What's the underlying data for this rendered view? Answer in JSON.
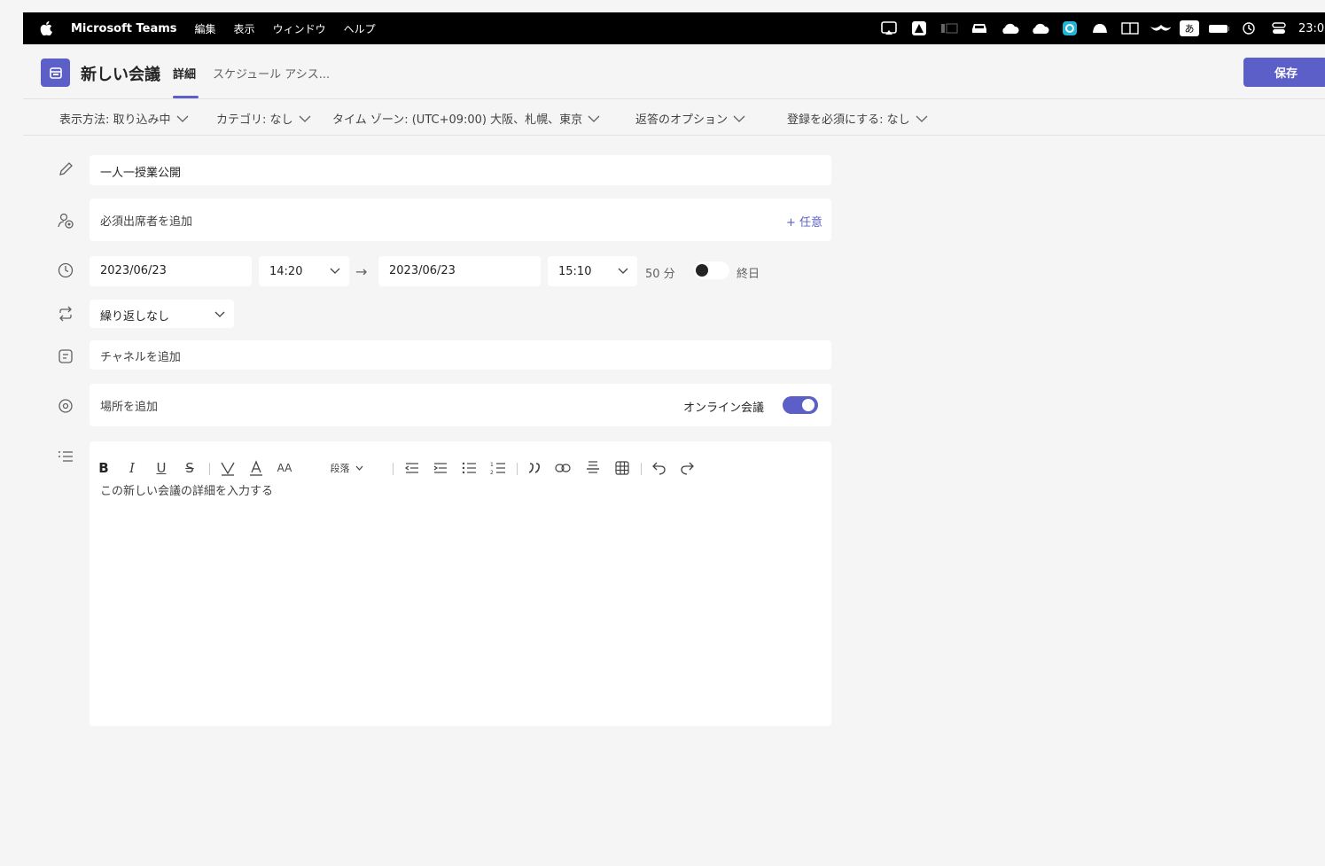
{
  "menubar": {
    "app": "Microsoft Teams",
    "items": [
      "編集",
      "表示",
      "ウィンドウ",
      "ヘルプ"
    ],
    "status_icons": [
      "screen-mirror-icon",
      "adobe-icon",
      "dots-icon",
      "car-icon",
      "cloud-icon",
      "cloud-icon",
      "edge-icon",
      "bell-icon",
      "book-icon",
      "mustache-icon",
      "input-method-icon",
      "battery-icon",
      "time-machine-icon",
      "control-center-icon"
    ],
    "input_method": "あ",
    "clock": "23:0"
  },
  "titlebar": {
    "title": "新しい会議",
    "tab_details": "詳細",
    "tab_schedule": "スケジュール アシス...",
    "save": "保存"
  },
  "options": {
    "show_as": "表示方法: 取り込み中",
    "category": "カテゴリ: なし",
    "timezone": "タイム ゾーン: (UTC+09:00) 大阪、札幌、東京",
    "response": "返答のオプション",
    "registration": "登録を必須にする: なし"
  },
  "form": {
    "title_value": "一人一授業公開",
    "attendees_placeholder": "必須出席者を追加",
    "optional_link": "+ 任意",
    "start_date": "2023/06/23",
    "start_time": "14:20",
    "arrow": "→",
    "end_date": "2023/06/23",
    "end_time": "15:10",
    "duration": "50 分",
    "all_day": "終日",
    "all_day_on": false,
    "repeat": "繰り返しなし",
    "channel_placeholder": "チャネルを追加",
    "location_placeholder": "場所を追加",
    "online_label": "オンライン会議",
    "online_on": true,
    "details_placeholder": "この新しい会議の詳細を入力する"
  },
  "toolbar": {
    "bold": "B",
    "italic": "I",
    "underline": "U",
    "strike": "S",
    "font_size": "AA",
    "paragraph": "段落"
  },
  "colors": {
    "accent": "#5b5fc7",
    "background": "#f5f5f5",
    "field": "#ffffff"
  }
}
